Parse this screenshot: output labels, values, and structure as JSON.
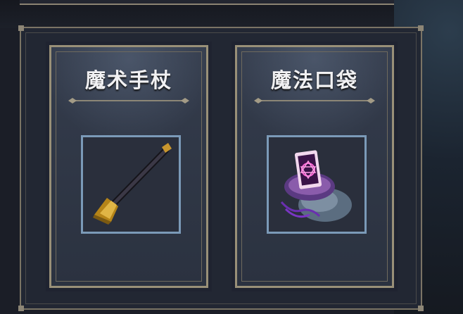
{
  "items": [
    {
      "name": "魔术手杖",
      "icon": "magic-wand-icon"
    },
    {
      "name": "魔法口袋",
      "icon": "magic-bag-icon"
    }
  ],
  "colors": {
    "background": "#1b1e27",
    "panel": "#222733",
    "card_border": "#999078",
    "frame_border": "#7b9ab8",
    "title_text": "#f1f1f3"
  }
}
